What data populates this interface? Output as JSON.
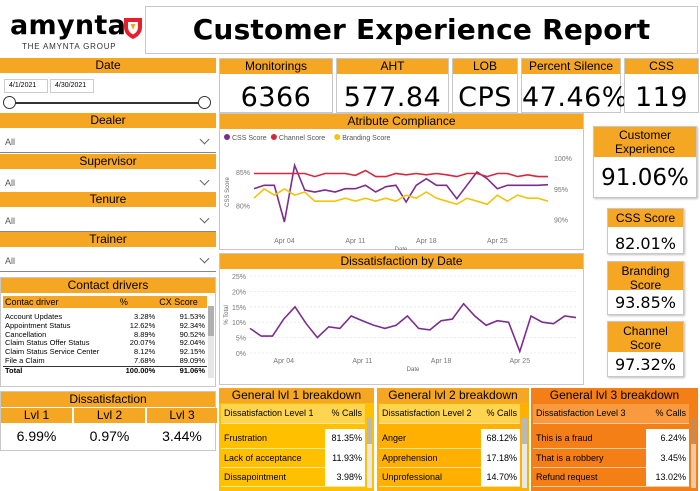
{
  "brand": {
    "name": "amynta",
    "tagline": "THE AMYNTA GROUP"
  },
  "title": "Customer Experience Report",
  "date": {
    "label": "Date",
    "start": "4/1/2021",
    "end": "4/30/2021"
  },
  "filters": [
    {
      "label": "Dealer",
      "value": "All"
    },
    {
      "label": "Supervisor",
      "value": "All"
    },
    {
      "label": "Tenure",
      "value": "All"
    },
    {
      "label": "Trainer",
      "value": "All"
    }
  ],
  "kpis": [
    {
      "label": "Monitorings",
      "value": "6366"
    },
    {
      "label": "AHT",
      "value": "577.84"
    },
    {
      "label": "LOB",
      "value": "CPS"
    },
    {
      "label": "Percent Silence",
      "value": "47.46%"
    },
    {
      "label": "CSS",
      "value": "119"
    }
  ],
  "cards": [
    {
      "label": "Customer Experience",
      "value": "91.06%"
    },
    {
      "label": "CSS Score",
      "value": "82.01%"
    },
    {
      "label": "Branding Score",
      "value": "93.85%"
    },
    {
      "label": "Channel Score",
      "value": "97.32%"
    }
  ],
  "contact_drivers": {
    "title": "Contact drivers",
    "columns": [
      "Contac driver",
      "%",
      "CX Score"
    ],
    "rows": [
      [
        "Account Updates",
        "3.28%",
        "91.53%"
      ],
      [
        "Appointment Status",
        "12.62%",
        "92.34%"
      ],
      [
        "Cancellation",
        "8.89%",
        "90.52%"
      ],
      [
        "Claim Status Offer Status",
        "20.07%",
        "92.04%"
      ],
      [
        "Claim Status Service Center",
        "8.12%",
        "92.15%"
      ],
      [
        "File a Claim",
        "7.68%",
        "89.09%"
      ]
    ],
    "total": [
      "Total",
      "100.00%",
      "91.06%"
    ]
  },
  "dissatisfaction": {
    "title": "Dissatisfaction",
    "levels": [
      {
        "label": "Lvl 1",
        "value": "6.99%"
      },
      {
        "label": "Lvl 2",
        "value": "0.97%"
      },
      {
        "label": "Lvl 3",
        "value": "3.44%"
      }
    ]
  },
  "breakdowns": [
    {
      "title": "General lvl 1 breakdown",
      "columns": [
        "Dissatisfaction Level 1",
        "% Calls"
      ],
      "rows": [
        [
          "Frustration",
          "81.35%"
        ],
        [
          "Lack of acceptance",
          "11.93%"
        ],
        [
          "Dissapointment",
          "3.98%"
        ]
      ],
      "color": "#FFC000"
    },
    {
      "title": "General lvl 2 breakdown",
      "columns": [
        "Dissatisfaction Level 2",
        "% Calls"
      ],
      "rows": [
        [
          "Anger",
          "68.12%"
        ],
        [
          "Apprehension",
          "17.18%"
        ],
        [
          "Unprofessional",
          "14.70%"
        ]
      ],
      "color": "#FFB000"
    },
    {
      "title": "General lvl 3 breakdown",
      "columns": [
        "Dissatisfaction Level 3",
        "% Calls"
      ],
      "rows": [
        [
          "This is a fraud",
          "6.24%"
        ],
        [
          "That is a robbery",
          "3.45%"
        ],
        [
          "Refund request",
          "13.02%"
        ]
      ],
      "color": "#F57F17"
    }
  ],
  "chart_data": [
    {
      "type": "line",
      "title": "Atribute Compliance",
      "xlabel": "Date",
      "ylabel": "CSS Score",
      "x_ticks": [
        "Apr 04",
        "Apr 11",
        "Apr 18",
        "Apr 25"
      ],
      "y_ticks_left": [
        "80%",
        "85%"
      ],
      "y_ticks_right": [
        "90%",
        "95%",
        "100%"
      ],
      "x": [
        "2021-04-01",
        "2021-04-02",
        "2021-04-03",
        "2021-04-04",
        "2021-04-05",
        "2021-04-06",
        "2021-04-07",
        "2021-04-08",
        "2021-04-09",
        "2021-04-10",
        "2021-04-11",
        "2021-04-12",
        "2021-04-13",
        "2021-04-14",
        "2021-04-15",
        "2021-04-16",
        "2021-04-17",
        "2021-04-18",
        "2021-04-19",
        "2021-04-20",
        "2021-04-21",
        "2021-04-22",
        "2021-04-23",
        "2021-04-24",
        "2021-04-25",
        "2021-04-26",
        "2021-04-27",
        "2021-04-28",
        "2021-04-29",
        "2021-04-30"
      ],
      "series": [
        {
          "name": "CSS Score",
          "color": "#7B2D8E",
          "axis": "left",
          "values": [
            82.5,
            83,
            83,
            77.5,
            86,
            82.3,
            82,
            82.3,
            82,
            82.5,
            82.5,
            83,
            82,
            82.8,
            83,
            80.5,
            83,
            84,
            83,
            83,
            81,
            83,
            85,
            84,
            82.5,
            83,
            83,
            83,
            83,
            83.1
          ]
        },
        {
          "name": "Channel Score",
          "color": "#D7263D",
          "axis": "right",
          "values": [
            97.5,
            97.5,
            97.5,
            97.5,
            97.5,
            97.5,
            97,
            97.5,
            97.5,
            97.5,
            97.2,
            98,
            97,
            97,
            97.5,
            97.3,
            97.5,
            97.3,
            97.5,
            97.3,
            97,
            97.5,
            97.5,
            97,
            97.5,
            97.5,
            97,
            97.3,
            97,
            97
          ]
        },
        {
          "name": "Branding Score",
          "color": "#F2C40F",
          "axis": "right",
          "values": [
            93.5,
            95,
            94,
            95,
            94,
            94.5,
            93,
            93,
            93,
            93.5,
            93,
            93.5,
            93,
            93.5,
            93,
            94,
            93.5,
            94.5,
            93.5,
            93,
            92.5,
            93.5,
            93,
            92.5,
            94,
            93,
            94,
            93.5,
            93.5,
            93
          ]
        }
      ],
      "ylim_left": [
        76,
        88
      ],
      "ylim_right": [
        88,
        101
      ],
      "legend": "top-left"
    },
    {
      "type": "line",
      "title": "Dissatisfaction by Date",
      "xlabel": "Date",
      "ylabel": "% Total",
      "x_ticks": [
        "Apr 04",
        "Apr 11",
        "Apr 18",
        "Apr 25"
      ],
      "y_ticks": [
        "0%",
        "5%",
        "10%",
        "15%",
        "20%",
        "25%"
      ],
      "x": [
        "2021-04-01",
        "2021-04-02",
        "2021-04-03",
        "2021-04-04",
        "2021-04-05",
        "2021-04-06",
        "2021-04-07",
        "2021-04-08",
        "2021-04-09",
        "2021-04-10",
        "2021-04-11",
        "2021-04-12",
        "2021-04-13",
        "2021-04-14",
        "2021-04-15",
        "2021-04-16",
        "2021-04-17",
        "2021-04-18",
        "2021-04-19",
        "2021-04-20",
        "2021-04-21",
        "2021-04-22",
        "2021-04-23",
        "2021-04-24",
        "2021-04-25",
        "2021-04-26",
        "2021-04-27",
        "2021-04-28",
        "2021-04-29",
        "2021-04-30"
      ],
      "series": [
        {
          "name": "Dissatisfaction",
          "color": "#7B2D8E",
          "values": [
            8,
            5.5,
            5.5,
            11,
            15,
            9.5,
            5,
            8.5,
            8,
            12,
            10.5,
            9,
            8,
            9,
            12,
            8,
            7.5,
            10.5,
            11,
            16,
            12,
            9,
            10.5,
            10,
            0.5,
            12,
            10,
            9.5,
            12,
            11.5
          ]
        }
      ],
      "ylim": [
        0,
        25
      ]
    }
  ]
}
